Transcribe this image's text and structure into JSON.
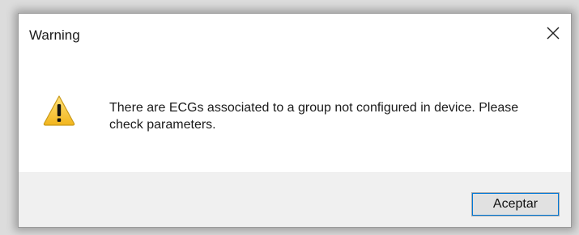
{
  "dialog": {
    "title": "Warning",
    "message": "There are ECGs associated to a group not configured in device. Please check parameters.",
    "icon": "warning-icon",
    "close_icon": "close-icon",
    "ok_label": "Aceptar"
  },
  "colors": {
    "warning_fill": "#f7c744",
    "warning_stroke": "#c99a1a",
    "accent_focus": "#0078d7",
    "footer_bg": "#f0f0f0"
  }
}
